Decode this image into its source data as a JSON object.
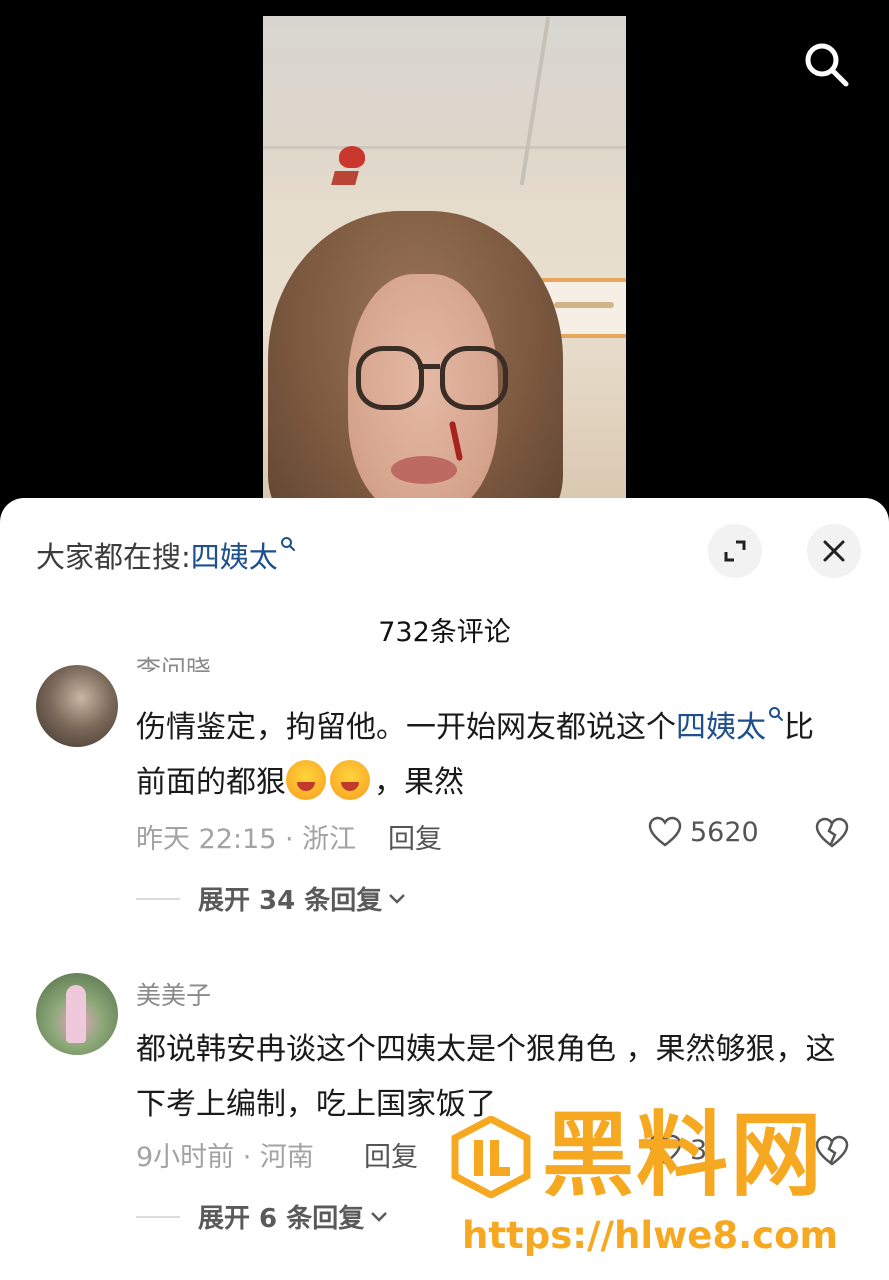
{
  "hot_search": {
    "prefix": "大家都在搜:",
    "term": "四姨太"
  },
  "comment_count": "732条评论",
  "comments": [
    {
      "username": "李问晓",
      "text_plain": "伤情鉴定，拘留他。一开始网友都说这个",
      "text_link": "四姨太",
      "text_after": "比前面的都狠",
      "text_end": "，果然",
      "time_location": "昨天 22:15 · 浙江",
      "reply": "回复",
      "likes": "5620",
      "expand": "展开 34 条回复"
    },
    {
      "username": "美美子",
      "text": "都说韩安冉谈这个四姨太是个狠角色 ，果然够狠，这下考上编制，吃上国家饭了",
      "time_location": "9小时前 · 河南",
      "reply": "回复",
      "likes": "3",
      "expand": "展开 6 条回复"
    }
  ],
  "watermark": {
    "text": "黑料网",
    "url": "https://hlwe8.com"
  },
  "colors": {
    "link_blue": "#1f4f8c",
    "watermark_orange": "#f5a820"
  }
}
